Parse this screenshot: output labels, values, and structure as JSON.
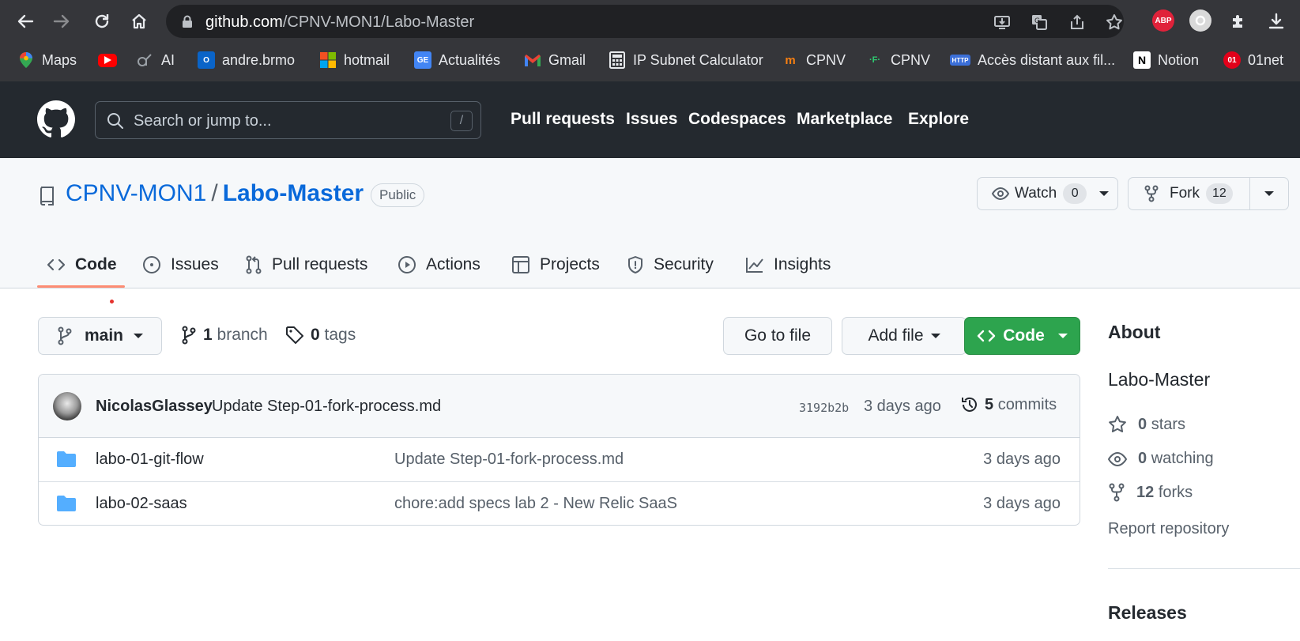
{
  "browser": {
    "url_host": "github.com",
    "url_path": "/CPNV-MON1/Labo-Master",
    "extensions": [
      {
        "name": "abp-icon",
        "label": "ABP",
        "color": "#e0223a"
      },
      {
        "name": "circle-extension-icon",
        "label": "",
        "color": "#d9d9d9"
      }
    ],
    "bookmarks": [
      {
        "label": "Maps",
        "icon": "maps-pin-icon"
      },
      {
        "label": "",
        "icon": "youtube-icon"
      },
      {
        "label": "AI",
        "icon": "ai-icon"
      },
      {
        "label": "andre.brmo",
        "icon": "outlook-icon"
      },
      {
        "label": "hotmail",
        "icon": "microsoft-icon"
      },
      {
        "label": "Actualités",
        "icon": "google-news-icon"
      },
      {
        "label": "Gmail",
        "icon": "gmail-icon"
      },
      {
        "label": "IP Subnet Calculator",
        "icon": "calculator-icon"
      },
      {
        "label": "CPNV",
        "icon": "moodle-icon"
      },
      {
        "label": "CPNV",
        "icon": "cpnv-icon"
      },
      {
        "label": "Accès distant aux fil...",
        "icon": "http-icon"
      },
      {
        "label": "Notion",
        "icon": "notion-icon"
      },
      {
        "label": "01net",
        "icon": "01net-icon"
      }
    ]
  },
  "github": {
    "search_placeholder": "Search or jump to...",
    "search_shortcut": "/",
    "nav": [
      "Pull requests",
      "Issues",
      "Codespaces",
      "Marketplace",
      "Explore"
    ]
  },
  "repo": {
    "owner": "CPNV-MON1",
    "separator": "/",
    "name": "Labo-Master",
    "visibility": "Public",
    "watch_label": "Watch",
    "watch_count": "0",
    "fork_label": "Fork",
    "fork_count": "12",
    "tabs": [
      {
        "label": "Code",
        "icon": "code-icon",
        "active": true
      },
      {
        "label": "Issues",
        "icon": "issue-icon",
        "active": false
      },
      {
        "label": "Pull requests",
        "icon": "pull-request-icon",
        "active": false
      },
      {
        "label": "Actions",
        "icon": "play-icon",
        "active": false
      },
      {
        "label": "Projects",
        "icon": "table-icon",
        "active": false
      },
      {
        "label": "Security",
        "icon": "shield-icon",
        "active": false
      },
      {
        "label": "Insights",
        "icon": "graph-icon",
        "active": false
      }
    ]
  },
  "toolbar": {
    "branch": "main",
    "branch_count": "1",
    "branch_word": "branch",
    "tag_count": "0",
    "tag_word": "tags",
    "go_to_file": "Go to file",
    "add_file": "Add file",
    "code": "Code"
  },
  "latest_commit": {
    "author": "NicolasGlassey",
    "message": "Update Step-01-fork-process.md",
    "sha": "3192b2b",
    "age": "3 days ago",
    "commit_count": "5",
    "commit_word": "commits"
  },
  "files": [
    {
      "name": "labo-01-git-flow",
      "message": "Update Step-01-fork-process.md",
      "age": "3 days ago"
    },
    {
      "name": "labo-02-saas",
      "message": "chore:add specs lab 2 - New Relic SaaS",
      "age": "3 days ago"
    }
  ],
  "about": {
    "heading": "About",
    "description": "Labo-Master",
    "stars_count": "0",
    "stars_word": "stars",
    "watching_count": "0",
    "watching_word": "watching",
    "forks_count": "12",
    "forks_word": "forks",
    "report": "Report repository",
    "releases_heading": "Releases"
  },
  "colors": {
    "chrome_bg": "#35363a",
    "github_header": "#24292f",
    "link_blue": "#0969da",
    "green_button": "#2da44e",
    "tab_underline": "#fd8c73",
    "folder_blue": "#54aeff"
  }
}
